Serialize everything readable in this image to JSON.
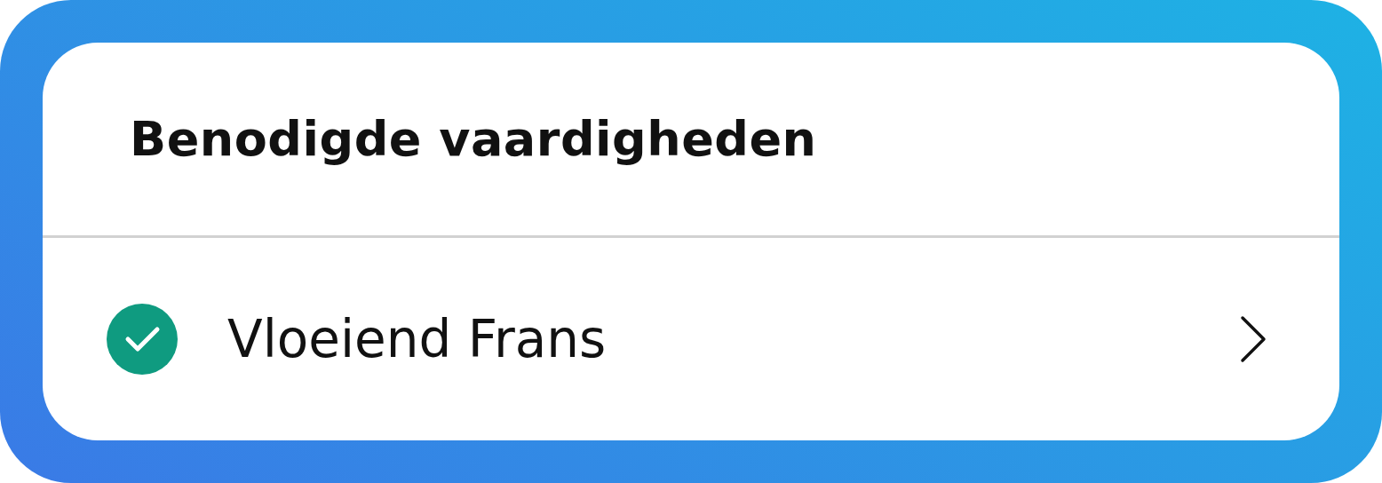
{
  "card": {
    "title": "Benodigde vaardigheden",
    "items": [
      {
        "label": "Vloeiend Frans",
        "checked": true
      }
    ]
  }
}
